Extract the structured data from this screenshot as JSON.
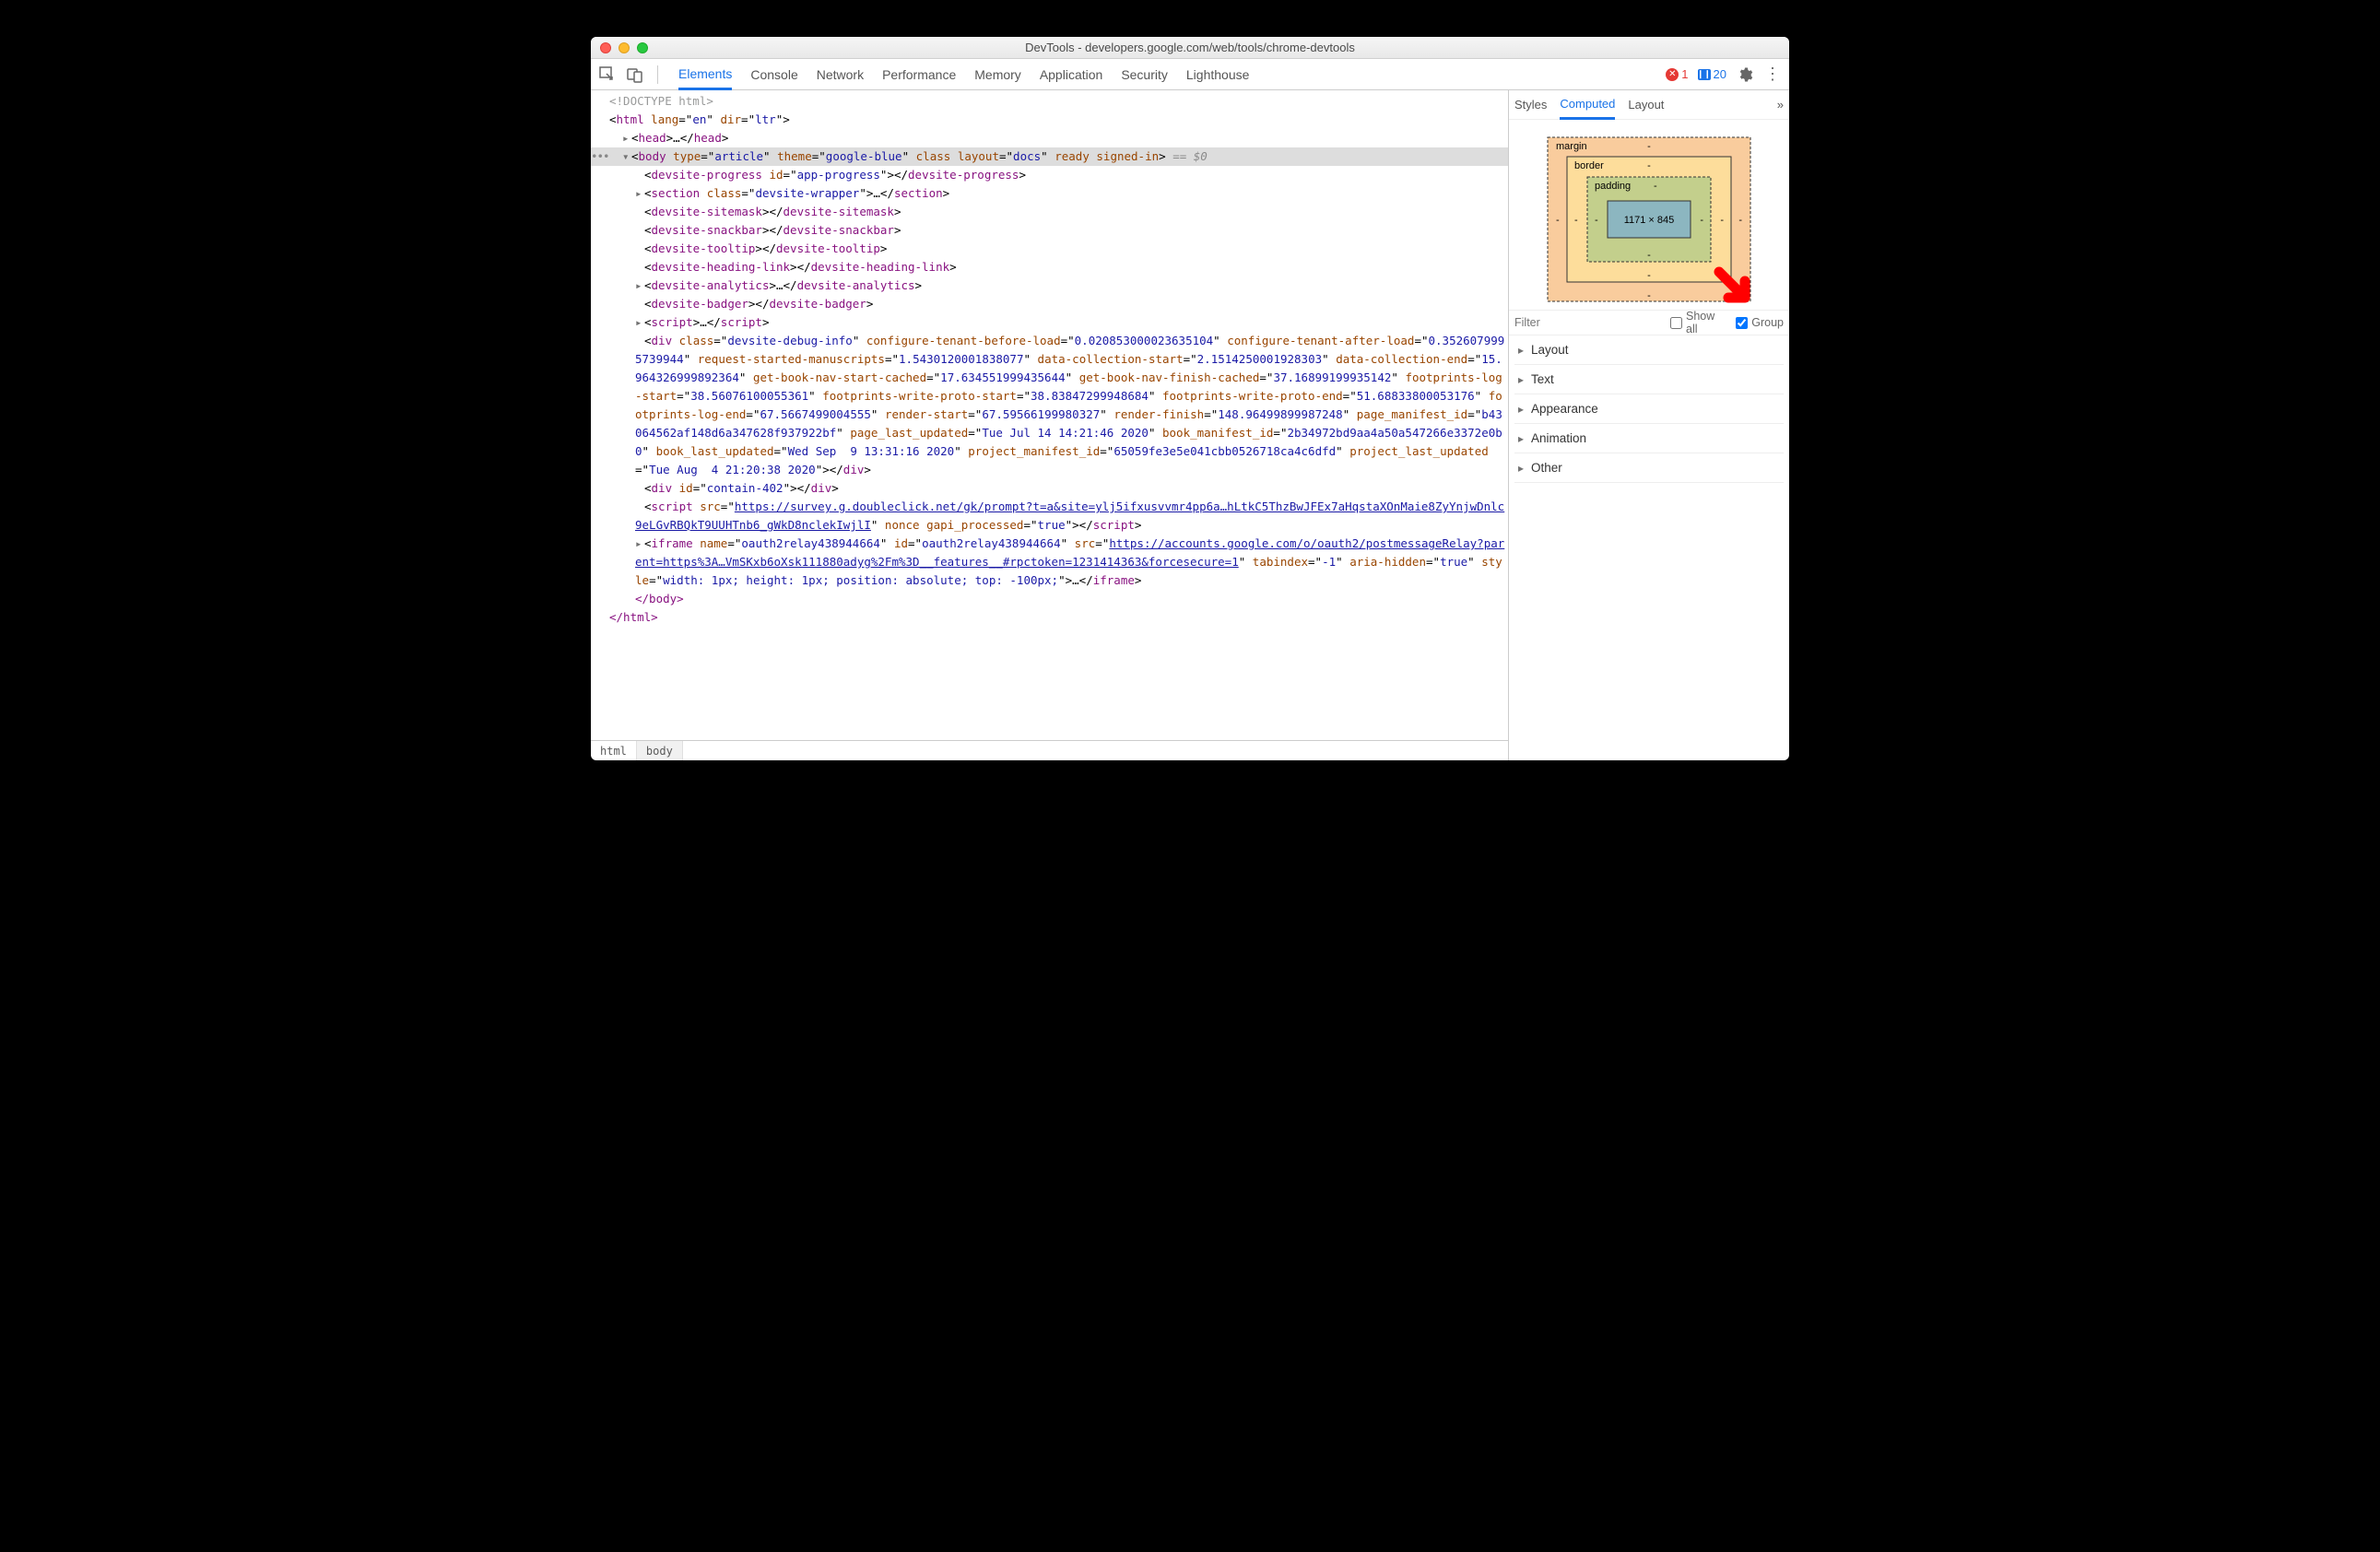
{
  "window": {
    "title": "DevTools - developers.google.com/web/tools/chrome-devtools"
  },
  "tabs": [
    "Elements",
    "Console",
    "Network",
    "Performance",
    "Memory",
    "Application",
    "Security",
    "Lighthouse"
  ],
  "tabs_active": "Elements",
  "errors": {
    "count": "1"
  },
  "messages": {
    "count": "20"
  },
  "dom": {
    "doctype": "<!DOCTYPE html>",
    "html_open": {
      "tag": "html",
      "attrs": [
        [
          "lang",
          "en"
        ],
        [
          "dir",
          "ltr"
        ]
      ]
    },
    "head": {
      "tag": "head",
      "ellipsis": "…"
    },
    "body_sel": {
      "tag": "body",
      "attrs": [
        [
          "type",
          "article"
        ],
        [
          "theme",
          "google-blue"
        ]
      ],
      "bare": [
        "class",
        "layout",
        "docs",
        "ready",
        "signed-in"
      ],
      "suffix": "== $0"
    },
    "children": [
      {
        "t": "elem",
        "tag": "devsite-progress",
        "attrs": [
          [
            "id",
            "app-progress"
          ]
        ],
        "close": true
      },
      {
        "t": "expand",
        "tag": "section",
        "attrs": [
          [
            "class",
            "devsite-wrapper"
          ]
        ],
        "ellipsis": "…"
      },
      {
        "t": "elem",
        "tag": "devsite-sitemask",
        "close": true
      },
      {
        "t": "elem",
        "tag": "devsite-snackbar",
        "close": true
      },
      {
        "t": "elem",
        "tag": "devsite-tooltip",
        "close": true
      },
      {
        "t": "elem",
        "tag": "devsite-heading-link",
        "close": true
      },
      {
        "t": "expand",
        "tag": "devsite-analytics",
        "ellipsis": "…"
      },
      {
        "t": "elem",
        "tag": "devsite-badger",
        "close": true
      },
      {
        "t": "expand",
        "tag": "script",
        "ellipsis": "…"
      }
    ],
    "debug_div": {
      "open": "div",
      "attrs_list": [
        [
          "class",
          "devsite-debug-info"
        ],
        [
          "configure-tenant-before-load",
          "0.020853000023635104"
        ],
        [
          "configure-tenant-after-load",
          "0.3526079995739944"
        ],
        [
          "request-started-manuscripts",
          "1.5430120001838077"
        ],
        [
          "data-collection-start",
          "2.1514250001928303"
        ],
        [
          "data-collection-end",
          "15.964326999892364"
        ],
        [
          "get-book-nav-start-cached",
          "17.634551999435644"
        ],
        [
          "get-book-nav-finish-cached",
          "37.16899199935142"
        ],
        [
          "footprints-log-start",
          "38.56076100055361"
        ],
        [
          "footprints-write-proto-start",
          "38.83847299948684"
        ],
        [
          "footprints-write-proto-end",
          "51.68833800053176"
        ],
        [
          "footprints-log-end",
          "67.5667499004555"
        ],
        [
          "render-start",
          "67.59566199980327"
        ],
        [
          "render-finish",
          "148.96499899987248"
        ],
        [
          "page_manifest_id",
          "b43064562af148d6a347628f937922bf"
        ],
        [
          "page_last_updated",
          "Tue Jul 14 14:21:46 2020"
        ],
        [
          "book_manifest_id",
          "2b34972bd9aa4a50a547266e3372e0b0"
        ],
        [
          "book_last_updated",
          "Wed Sep  9 13:31:16 2020"
        ],
        [
          "project_manifest_id",
          "65059fe3e5e041cbb0526718ca4c6dfd"
        ],
        [
          "project_last_updated",
          "Tue Aug  4 21:20:38 2020"
        ]
      ]
    },
    "contain_div": {
      "tag": "div",
      "attrs": [
        [
          "id",
          "contain-402"
        ]
      ]
    },
    "script_src": {
      "tag": "script",
      "src": "https://survey.g.doubleclick.net/gk/prompt?t=a&site=ylj5ifxusvvmr4pp6a…hLtkC5ThzBwJFEx7aHqstaXOnMaie8ZyYnjwDnlc9eLGvRBQkT9UUHTnb6_gWkD8nclekIwjlI",
      "extra": " nonce gapi_processed",
      "extra_v": "true"
    },
    "iframe": {
      "tag": "iframe",
      "name": "oauth2relay438944664",
      "id": "oauth2relay438944664",
      "src": "https://accounts.google.com/o/oauth2/postmessageRelay?parent=https%3A…VmSKxb6oXsk111880adyg%2Fm%3D__features__#rpctoken=1231414363&forcesecure=1",
      "tabindex": "-1",
      "aria_hidden": "true",
      "style": "width: 1px; height: 1px; position: absolute; top: -100px;",
      "ellipsis": "…"
    }
  },
  "crumbs": [
    "html",
    "body"
  ],
  "side_tabs": [
    "Styles",
    "Computed",
    "Layout"
  ],
  "side_active": "Computed",
  "boxmodel": {
    "margin": "margin",
    "border": "border",
    "padding": "padding",
    "content": "1171 × 845",
    "dash": "-"
  },
  "filter": {
    "placeholder": "Filter",
    "showall": "Show all",
    "group": "Group",
    "group_checked": true
  },
  "groups": [
    "Layout",
    "Text",
    "Appearance",
    "Animation",
    "Other"
  ]
}
